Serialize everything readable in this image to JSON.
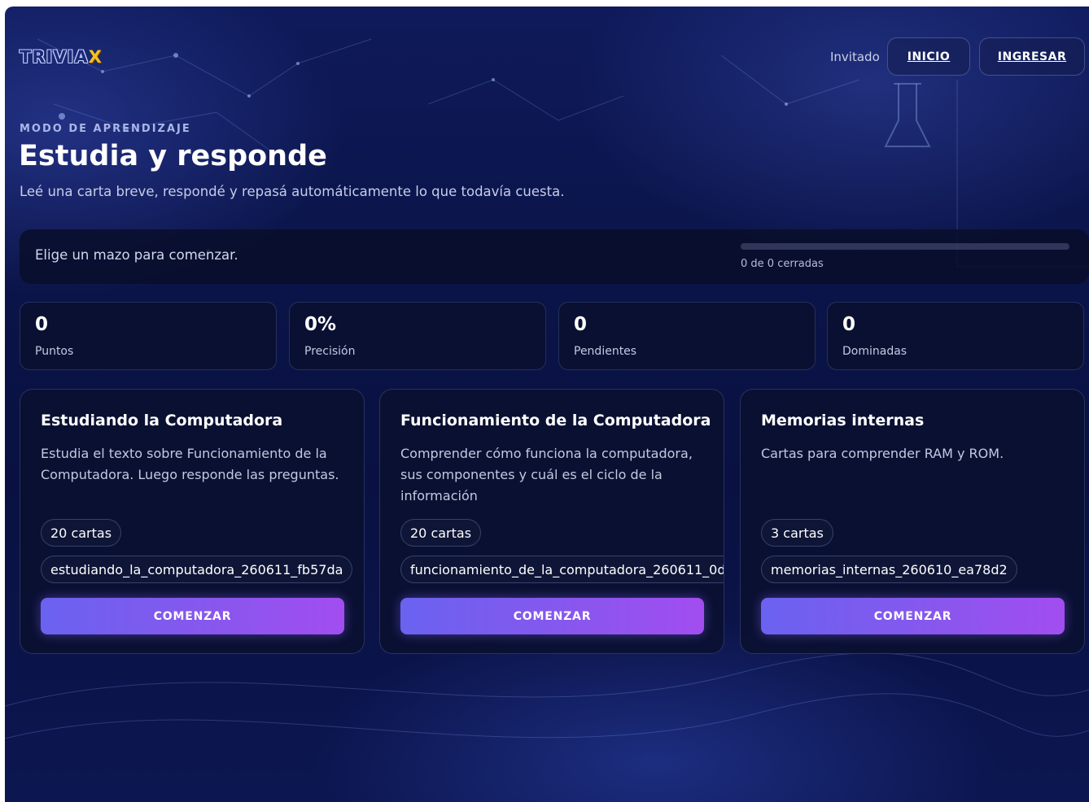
{
  "header": {
    "logo_text": "TRIVIA",
    "logo_accent": "X",
    "guest_label": "Invitado",
    "nav": {
      "home_label": "INICIO",
      "login_label": "INGRESAR"
    }
  },
  "hero": {
    "eyebrow": "MODO DE APRENDIZAJE",
    "title": "Estudia y responde",
    "subtitle": "Leé una carta breve, respondé y repasá automáticamente lo que todavía cuesta."
  },
  "status": {
    "message": "Elige un mazo para comenzar.",
    "progress_text": "0 de 0 cerradas",
    "progress_fraction": 0
  },
  "stats": [
    {
      "value": "0",
      "label": "Puntos"
    },
    {
      "value": "0%",
      "label": "Precisión"
    },
    {
      "value": "0",
      "label": "Pendientes"
    },
    {
      "value": "0",
      "label": "Dominadas"
    }
  ],
  "decks": [
    {
      "title": "Estudiando la Computadora",
      "description": "Estudia el texto sobre Funcionamiento de la Computadora. Luego responde las preguntas.",
      "count": "20 cartas",
      "id": "estudiando_la_computadora_260611_fb57da",
      "button": "COMENZAR"
    },
    {
      "title": "Funcionamiento de la Computadora",
      "description": "Comprender cómo funciona la computadora, sus componentes y cuál es el ciclo de la información",
      "count": "20 cartas",
      "id": "funcionamiento_de_la_computadora_260611_0d2a",
      "button": "COMENZAR"
    },
    {
      "title": "Memorias internas",
      "description": "Cartas para comprender RAM y ROM.",
      "count": "3 cartas",
      "id": "memorias_internas_260610_ea78d2",
      "button": "COMENZAR"
    }
  ],
  "colors": {
    "accent_start": "#6a62f0",
    "accent_end": "#a24df0",
    "background": "#0b1448",
    "logo_accent": "#f6c21a"
  }
}
